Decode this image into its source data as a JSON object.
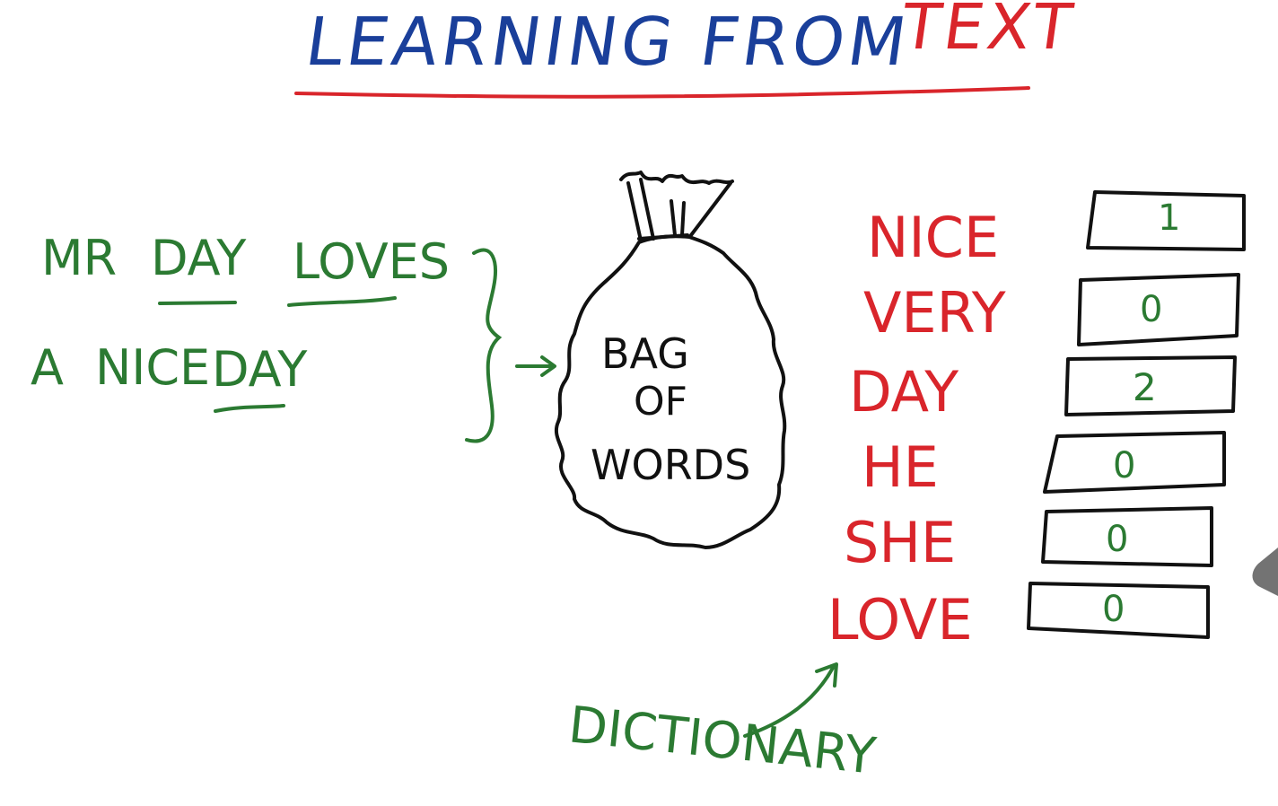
{
  "title": {
    "part1": "LEARNING FROM",
    "part2": "TEXT"
  },
  "sentences": {
    "line1": {
      "w1": "MR",
      "w2": "DAY",
      "w3": "LOVES"
    },
    "line2": {
      "w1": "A",
      "w2": "NICE",
      "w3": "DAY"
    }
  },
  "bag": {
    "line1": "BAG",
    "line2": "OF",
    "line3": "WORDS"
  },
  "dictionary_label": "DICTIONARY",
  "dictionary": [
    {
      "word": "NICE",
      "count": "1"
    },
    {
      "word": "VERY",
      "count": "0"
    },
    {
      "word": "DAY",
      "count": "2"
    },
    {
      "word": "HE",
      "count": "0"
    },
    {
      "word": "SHE",
      "count": "0"
    },
    {
      "word": "LOVE",
      "count": "0"
    }
  ],
  "colors": {
    "title_blue": "#1a3f9a",
    "accent_red": "#d9252b",
    "ink_green": "#2b7a32",
    "ink_black": "#111111"
  }
}
